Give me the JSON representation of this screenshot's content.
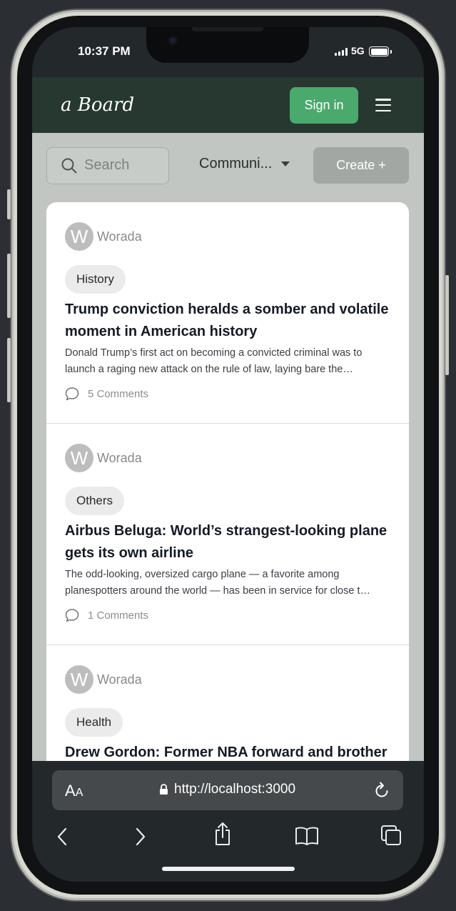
{
  "status_bar": {
    "time": "10:37 PM",
    "network": "5G"
  },
  "header": {
    "logo": "a Board",
    "signin_label": "Sign in"
  },
  "toolbar": {
    "search_placeholder": "Search",
    "community_label": "Communi...",
    "create_label": "Create +"
  },
  "posts": [
    {
      "author": "Worada",
      "avatar_letter": "W",
      "tag": "History",
      "title": "Trump conviction heralds a somber and volatile moment in American history",
      "excerpt": "Donald Trump’s first act on becoming a convicted criminal was to launch a raging new attack on the rule of law, laying bare the…",
      "comments": "5 Comments"
    },
    {
      "author": "Worada",
      "avatar_letter": "W",
      "tag": "Others",
      "title": "Airbus Beluga: World’s strangest-looking plane gets its own airline",
      "excerpt": "The odd-looking, oversized cargo plane — a favorite among planespotters around the world — has been in service for close t…",
      "comments": "1 Comments"
    },
    {
      "author": "Worada",
      "avatar_letter": "W",
      "tag": "Health",
      "title": "Drew Gordon: Former NBA forward and brother",
      "excerpt": "",
      "comments": ""
    }
  ],
  "browser": {
    "text_size_label": "AA",
    "url": "http://localhost:3000"
  },
  "icons": {
    "search": "search-icon",
    "caret": "chevron-down-icon",
    "menu": "hamburger-menu-icon",
    "comment": "speech-bubble-icon",
    "lock": "lock-icon",
    "reload": "reload-icon",
    "back": "chevron-left-icon",
    "forward": "chevron-right-icon",
    "share": "share-icon",
    "bookmarks": "book-icon",
    "tabs": "tabs-icon"
  },
  "colors": {
    "header_bg": "#26382f",
    "signin_bg": "#4aa96c",
    "content_bg": "#c1c6c2",
    "create_bg": "#a3a7a4"
  }
}
